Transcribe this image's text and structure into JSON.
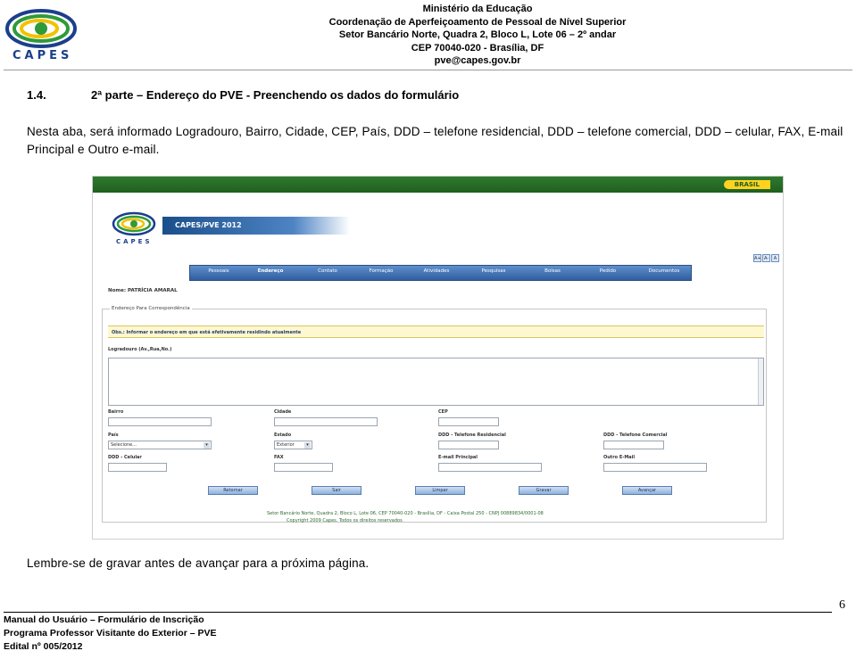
{
  "header": {
    "logo_text": "CAPES",
    "org_lines": [
      "Ministério da Educação",
      "Coordenação de Aperfeiçoamento de Pessoal de Nível Superior",
      "Setor Bancário Norte, Quadra 2, Bloco L, Lote 06 – 2º andar",
      "CEP 70040-020 - Brasília, DF",
      "pve@capes.gov.br"
    ]
  },
  "section": {
    "number": "1.4.",
    "title": "2ª parte – Endereço do PVE - Preenchendo os dados do formulário",
    "intro": "Nesta aba, será informado Logradouro, Bairro, Cidade, CEP, País, DDD – telefone residencial, DDD – telefone comercial, DDD – celular, FAX, E-mail Principal e Outro e-mail."
  },
  "screenshot": {
    "gov_tag": "BRASIL",
    "logo_text": "CAPES",
    "banner": "CAPES/PVE 2012",
    "font_buttons": [
      "A+",
      "A-",
      "A"
    ],
    "nav": [
      {
        "label": "Pessoais",
        "active": false
      },
      {
        "label": "Endereço",
        "active": true
      },
      {
        "label": "Contato",
        "active": false
      },
      {
        "label": "Formação",
        "active": false
      },
      {
        "label": "Atividades",
        "active": false
      },
      {
        "label": "Pesquisas",
        "active": false
      },
      {
        "label": "Bolsas",
        "active": false
      },
      {
        "label": "Pedido",
        "active": false
      },
      {
        "label": "Documentos",
        "active": false
      }
    ],
    "name_label": "Nome: PATRÍCIA AMARAL",
    "fieldset_legend": "Endereço Para Correspondência",
    "notice": "Obs.: Informar o endereço em que está efetivamente residindo atualmente",
    "labels": {
      "logradouro": "Logradouro (Av.,Rua,No.)",
      "bairro": "Bairro",
      "cidade": "Cidade",
      "cep": "CEP",
      "pais": "País",
      "estado": "Estado",
      "ddd_res": "DDD - Telefone Residencial",
      "ddd_com": "DDD - Telefone Comercial",
      "ddd_cel": "DDD - Celular",
      "fax": "FAX",
      "email": "E-mail Principal",
      "outro_email": "Outro E-Mail"
    },
    "pais_value": "Selecione...",
    "estado_value": "Exterior",
    "buttons": [
      "Retornar",
      "Sair",
      "Limpar",
      "Gravar",
      "Avançar"
    ],
    "footer_lines": [
      "Setor Bancário Norte, Quadra 2, Bloco L, Lote 06, CEP 70040-020 - Brasília, DF - Caixa Postal 250 - CNPJ 00889834/0001-08",
      "Copyright 2009 Capes. Todos os direitos reservados"
    ]
  },
  "reminder": "Lembre-se de gravar antes de avançar para a próxima página.",
  "page_number": "6",
  "footer": {
    "lines": [
      "Manual do Usuário – Formulário de Inscrição",
      "Programa Professor Visitante do Exterior – PVE",
      "Edital nº 005/2012"
    ]
  }
}
